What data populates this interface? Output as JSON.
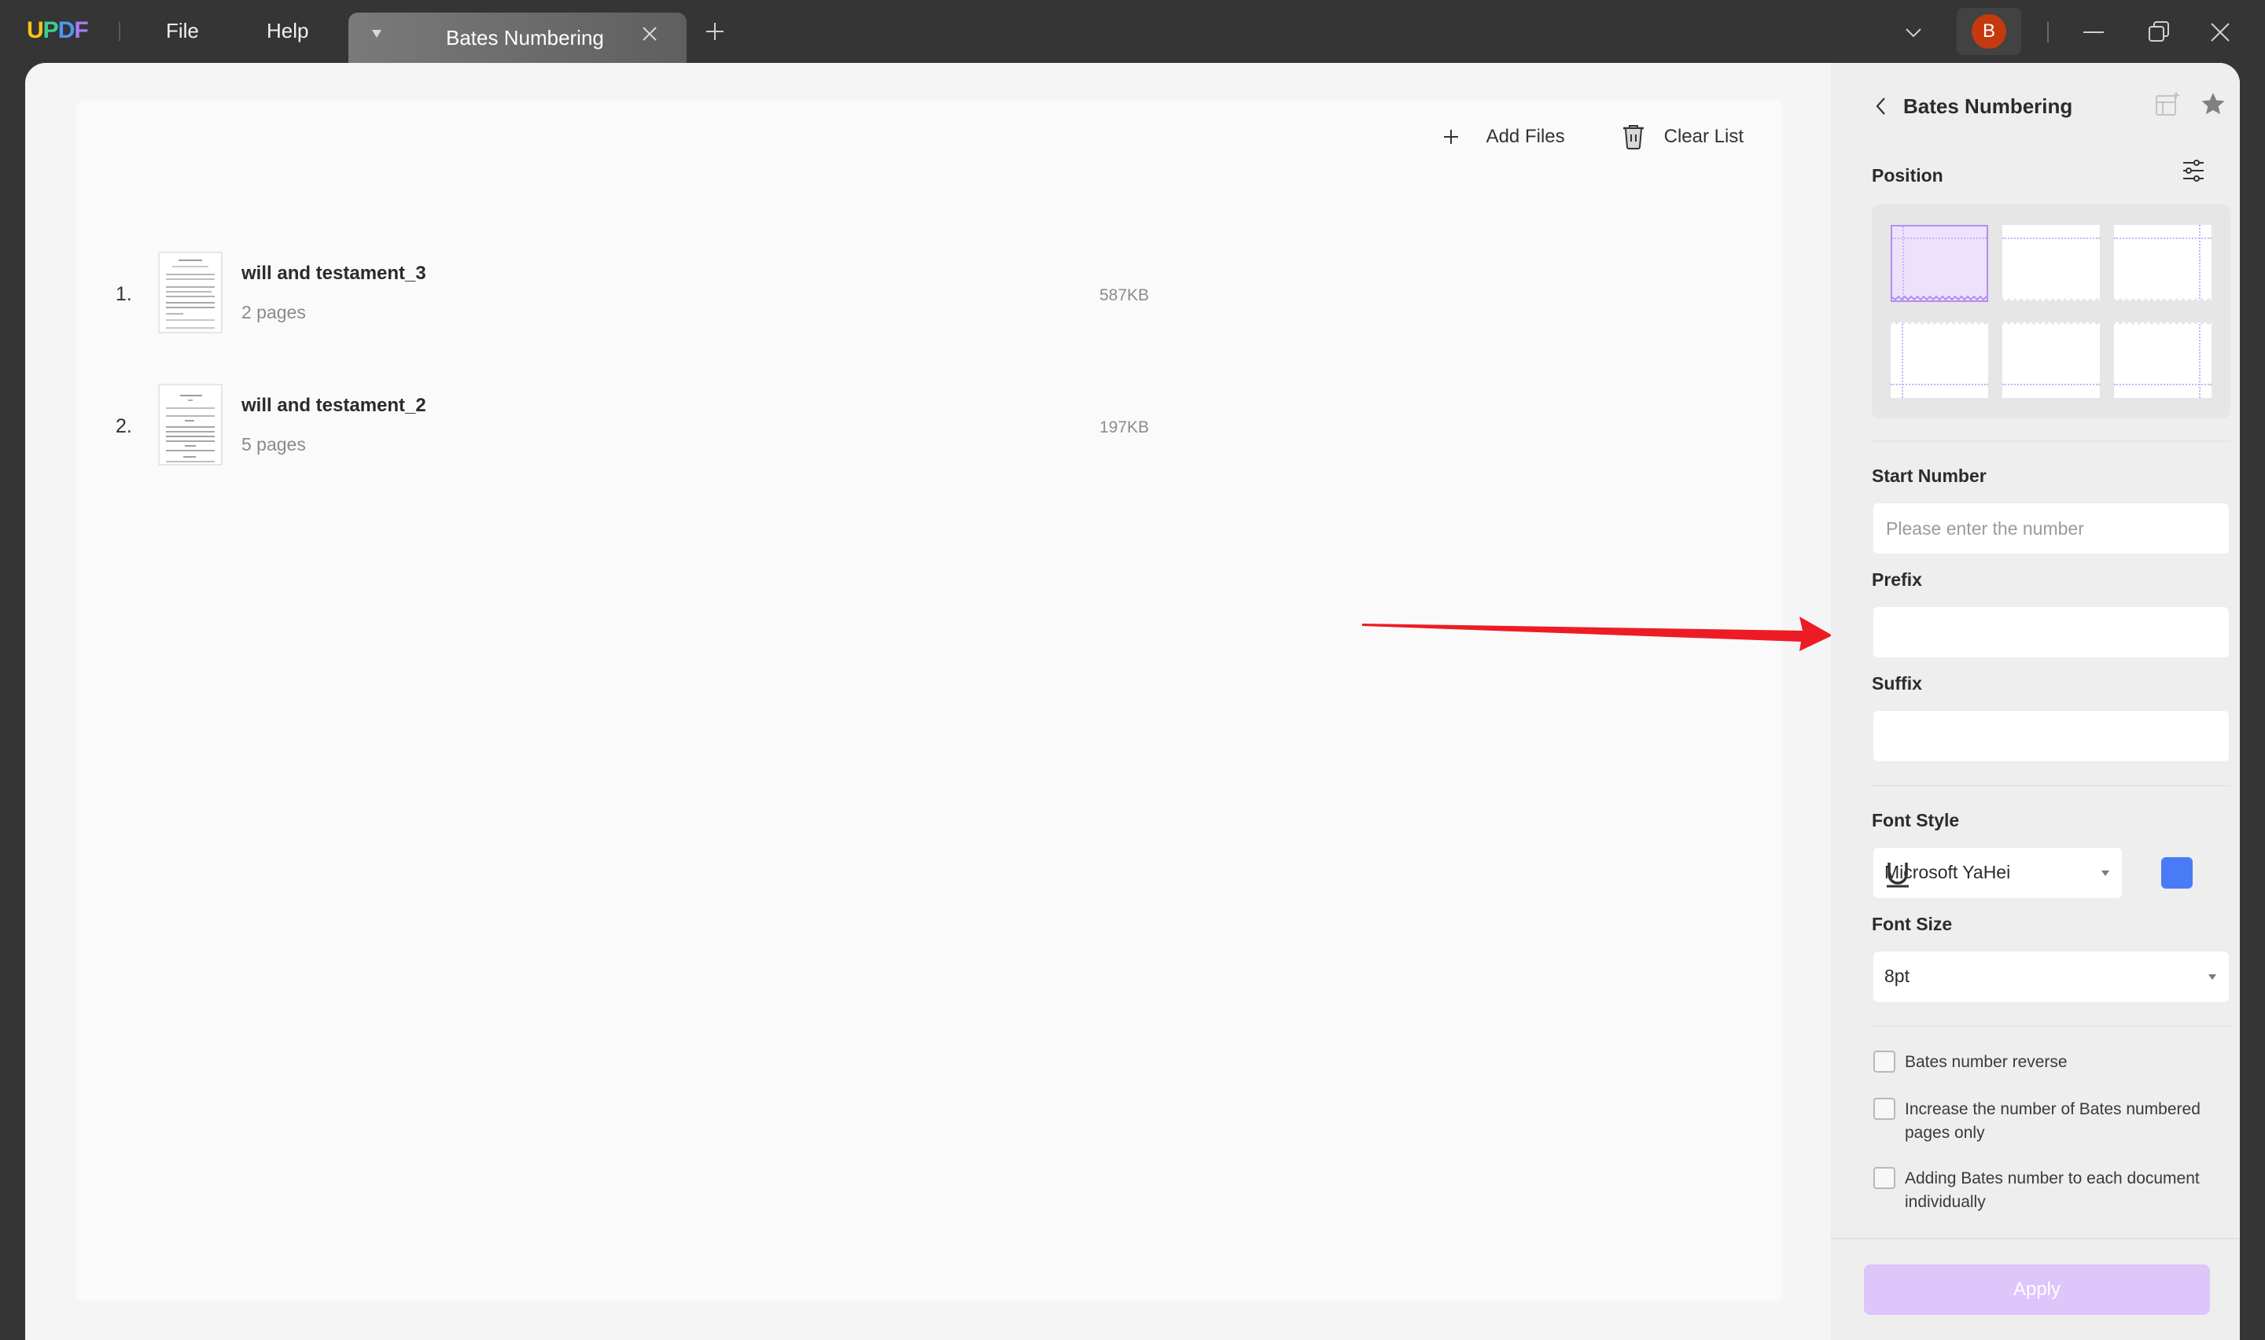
{
  "app": {
    "logo_letters": [
      {
        "char": "U",
        "color": "#f5c518"
      },
      {
        "char": "P",
        "color": "#3ecf8e"
      },
      {
        "char": "D",
        "color": "#4a9af5"
      },
      {
        "char": "F",
        "color": "#a77cf2"
      }
    ],
    "menu": [
      "File",
      "Help"
    ],
    "tab": {
      "title": "Bates Numbering",
      "close_icon": "close-icon",
      "dropdown_icon": "caret-down-icon"
    },
    "new_tab_icon": "plus-icon",
    "avatar_letter": "B",
    "avatar_color": "#c6390e",
    "window_controls": [
      "minimize-icon",
      "restore-icon",
      "close-icon"
    ]
  },
  "file_list": {
    "actions": {
      "add_files": "Add Files",
      "clear_list": "Clear List"
    },
    "files": [
      {
        "index": "1.",
        "name": "will and testament_3",
        "pages": "2 pages",
        "size": "587KB"
      },
      {
        "index": "2.",
        "name": "will and testament_2",
        "pages": "5 pages",
        "size": "197KB"
      }
    ]
  },
  "panel": {
    "title": "Bates Numbering",
    "position": {
      "label": "Position",
      "options": [
        "top-left",
        "top-center",
        "top-right",
        "bottom-left",
        "bottom-center",
        "bottom-right"
      ],
      "selected": "top-left"
    },
    "start_number": {
      "label": "Start Number",
      "placeholder": "Please enter the number",
      "value": ""
    },
    "prefix": {
      "label": "Prefix",
      "value": ""
    },
    "suffix": {
      "label": "Suffix",
      "value": ""
    },
    "font_style": {
      "label": "Font Style",
      "value": "Microsoft YaHei",
      "color": "#4a7bf7"
    },
    "font_size": {
      "label": "Font Size",
      "value": "8pt"
    },
    "checkboxes": [
      {
        "label": "Bates number reverse",
        "checked": false
      },
      {
        "label": "Increase the number of Bates numbered pages only",
        "checked": false
      },
      {
        "label": "Adding Bates number to each document individually",
        "checked": false
      }
    ],
    "apply_label": "Apply",
    "accent_color": "#b48cf2"
  },
  "annotation": {
    "type": "red-arrow",
    "color": "#ed1c24"
  }
}
